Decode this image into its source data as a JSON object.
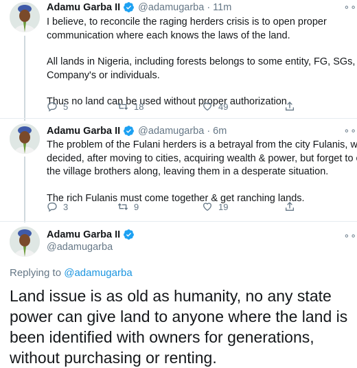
{
  "colors": {
    "accent": "#1da1f2",
    "muted": "#657786",
    "link": "#1b95e0",
    "verified": "#1da1f2"
  },
  "author": {
    "name": "Adamu Garba II",
    "handle": "@adamugarba"
  },
  "tweets": [
    {
      "time": "11m",
      "paragraphs": [
        "I believe, to reconcile the raging herders crisis is to open proper communication where each knows the laws of the land.",
        "All lands in Nigeria, including forests belongs to some entity, FG, SGs, LGs, Company's or individuals.",
        "Thus no land can be used without proper authorization"
      ],
      "lines": [
        [
          "I believe, to reconcile the raging herders crisis is to open proper",
          "communication where each knows the laws of the land."
        ],
        [
          "All lands in Nigeria, including forests belongs to some entity, FG, SGs, LGs,",
          "Company's or individuals."
        ],
        [
          "Thus no land can be used without proper authorization"
        ]
      ],
      "replies": "5",
      "retweets": "18",
      "likes": "49"
    },
    {
      "time": "6m",
      "lines": [
        [
          "The problem of the Fulani herders is a betrayal from the city Fulanis, who",
          "decided, after moving to cities, acquiring wealth & power, but forget to carry",
          "the village brothers along, leaving them in a desperate situation."
        ],
        [
          "The rich Fulanis must come together & get ranching lands."
        ]
      ],
      "replies": "3",
      "retweets": "9",
      "likes": "19"
    }
  ],
  "main": {
    "replying_label": "Replying to",
    "replying_handle": "@adamugarba",
    "text": "Land issue is as old as humanity, no any state power can give land to anyone where the land is been identified with owners for generations, without purchasing or renting."
  },
  "icons": {
    "more": "more-icon",
    "reply": "reply-icon",
    "retweet": "retweet-icon",
    "like": "heart-icon",
    "share": "share-icon",
    "verified": "verified-icon"
  }
}
